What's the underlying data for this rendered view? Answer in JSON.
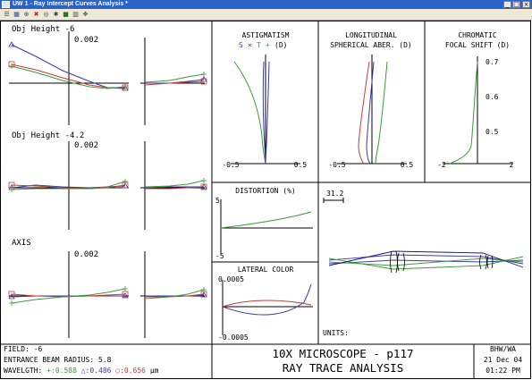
{
  "window": {
    "title": "UW 1 - Ray Intercept Curves Analysis *",
    "btn_min": "_",
    "btn_max": "□",
    "btn_close": "×"
  },
  "toolbar": [
    "pan-icon",
    "grid-icon",
    "zoom-icon",
    "close-x-icon",
    "target-icon",
    "settings-icon",
    "stop-icon",
    "film-icon",
    "move-icon"
  ],
  "fan_labels": {
    "field1": "Obj Height -6",
    "scale1": "0.002",
    "field2": "Obj Height -4.2",
    "scale2": "0.002",
    "field3": "AXIS",
    "scale3": "0.002"
  },
  "astig": {
    "title": "ASTIGMATISM",
    "legend_s": "S",
    "legend_x": "×",
    "legend_t": "T",
    "legend_plus": "+",
    "legend_d": "(D)",
    "tick_left": "-0.5",
    "tick_right": "0.5"
  },
  "long": {
    "title1": "LONGITUDINAL",
    "title2": "SPHERICAL ABER. (D)",
    "tick_left": "-0.5",
    "tick_right": "0.5"
  },
  "chrom": {
    "title1": "CHROMATIC",
    "title2": "FOCAL SHIFT (D)",
    "y1": "0.7",
    "y2": "0.6",
    "y3": "0.5",
    "tick_left": "-2",
    "tick_right": "2"
  },
  "dist": {
    "title": "DISTORTION (%)",
    "y_top": "5",
    "y_bot": "-5"
  },
  "latcol": {
    "title": "LATERAL COLOR",
    "y_top": "0.0005",
    "y_bot": "-0.0005"
  },
  "layout": {
    "scale_bar": "31.2",
    "units": "UNITS:"
  },
  "footer": {
    "field": "FIELD: -6",
    "beam": "ENTRANCE BEAM RADIUS: 5.8",
    "wl_label": "WAVELGTH:",
    "wl1": "+:0.588",
    "wl2": "△:0.486",
    "wl3": "○:0.656",
    "wl_unit": "µm",
    "title1": "10X MICROSCOPE - p117",
    "title2": "RAY TRACE ANALYSIS",
    "author": "BHW/WA",
    "date": "21 Dec 04",
    "time": "01:22 PM"
  },
  "colors": {
    "green": "#3a9a3a",
    "blue": "#3a3aa8",
    "red": "#c83a3a",
    "frame": "#000000",
    "titlebar": "#2a62c8"
  }
}
